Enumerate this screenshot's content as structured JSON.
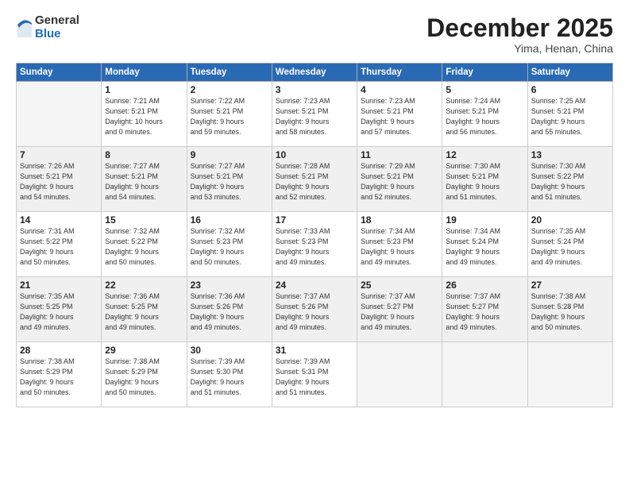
{
  "logo": {
    "general": "General",
    "blue": "Blue"
  },
  "title": "December 2025",
  "location": "Yima, Henan, China",
  "days_header": [
    "Sunday",
    "Monday",
    "Tuesday",
    "Wednesday",
    "Thursday",
    "Friday",
    "Saturday"
  ],
  "weeks": [
    [
      {
        "day": "",
        "info": ""
      },
      {
        "day": "1",
        "info": "Sunrise: 7:21 AM\nSunset: 5:21 PM\nDaylight: 10 hours\nand 0 minutes."
      },
      {
        "day": "2",
        "info": "Sunrise: 7:22 AM\nSunset: 5:21 PM\nDaylight: 9 hours\nand 59 minutes."
      },
      {
        "day": "3",
        "info": "Sunrise: 7:23 AM\nSunset: 5:21 PM\nDaylight: 9 hours\nand 58 minutes."
      },
      {
        "day": "4",
        "info": "Sunrise: 7:23 AM\nSunset: 5:21 PM\nDaylight: 9 hours\nand 57 minutes."
      },
      {
        "day": "5",
        "info": "Sunrise: 7:24 AM\nSunset: 5:21 PM\nDaylight: 9 hours\nand 56 minutes."
      },
      {
        "day": "6",
        "info": "Sunrise: 7:25 AM\nSunset: 5:21 PM\nDaylight: 9 hours\nand 55 minutes."
      }
    ],
    [
      {
        "day": "7",
        "info": "Sunrise: 7:26 AM\nSunset: 5:21 PM\nDaylight: 9 hours\nand 54 minutes."
      },
      {
        "day": "8",
        "info": "Sunrise: 7:27 AM\nSunset: 5:21 PM\nDaylight: 9 hours\nand 54 minutes."
      },
      {
        "day": "9",
        "info": "Sunrise: 7:27 AM\nSunset: 5:21 PM\nDaylight: 9 hours\nand 53 minutes."
      },
      {
        "day": "10",
        "info": "Sunrise: 7:28 AM\nSunset: 5:21 PM\nDaylight: 9 hours\nand 52 minutes."
      },
      {
        "day": "11",
        "info": "Sunrise: 7:29 AM\nSunset: 5:21 PM\nDaylight: 9 hours\nand 52 minutes."
      },
      {
        "day": "12",
        "info": "Sunrise: 7:30 AM\nSunset: 5:21 PM\nDaylight: 9 hours\nand 51 minutes."
      },
      {
        "day": "13",
        "info": "Sunrise: 7:30 AM\nSunset: 5:22 PM\nDaylight: 9 hours\nand 51 minutes."
      }
    ],
    [
      {
        "day": "14",
        "info": "Sunrise: 7:31 AM\nSunset: 5:22 PM\nDaylight: 9 hours\nand 50 minutes."
      },
      {
        "day": "15",
        "info": "Sunrise: 7:32 AM\nSunset: 5:22 PM\nDaylight: 9 hours\nand 50 minutes."
      },
      {
        "day": "16",
        "info": "Sunrise: 7:32 AM\nSunset: 5:23 PM\nDaylight: 9 hours\nand 50 minutes."
      },
      {
        "day": "17",
        "info": "Sunrise: 7:33 AM\nSunset: 5:23 PM\nDaylight: 9 hours\nand 49 minutes."
      },
      {
        "day": "18",
        "info": "Sunrise: 7:34 AM\nSunset: 5:23 PM\nDaylight: 9 hours\nand 49 minutes."
      },
      {
        "day": "19",
        "info": "Sunrise: 7:34 AM\nSunset: 5:24 PM\nDaylight: 9 hours\nand 49 minutes."
      },
      {
        "day": "20",
        "info": "Sunrise: 7:35 AM\nSunset: 5:24 PM\nDaylight: 9 hours\nand 49 minutes."
      }
    ],
    [
      {
        "day": "21",
        "info": "Sunrise: 7:35 AM\nSunset: 5:25 PM\nDaylight: 9 hours\nand 49 minutes."
      },
      {
        "day": "22",
        "info": "Sunrise: 7:36 AM\nSunset: 5:25 PM\nDaylight: 9 hours\nand 49 minutes."
      },
      {
        "day": "23",
        "info": "Sunrise: 7:36 AM\nSunset: 5:26 PM\nDaylight: 9 hours\nand 49 minutes."
      },
      {
        "day": "24",
        "info": "Sunrise: 7:37 AM\nSunset: 5:26 PM\nDaylight: 9 hours\nand 49 minutes."
      },
      {
        "day": "25",
        "info": "Sunrise: 7:37 AM\nSunset: 5:27 PM\nDaylight: 9 hours\nand 49 minutes."
      },
      {
        "day": "26",
        "info": "Sunrise: 7:37 AM\nSunset: 5:27 PM\nDaylight: 9 hours\nand 49 minutes."
      },
      {
        "day": "27",
        "info": "Sunrise: 7:38 AM\nSunset: 5:28 PM\nDaylight: 9 hours\nand 50 minutes."
      }
    ],
    [
      {
        "day": "28",
        "info": "Sunrise: 7:38 AM\nSunset: 5:29 PM\nDaylight: 9 hours\nand 50 minutes."
      },
      {
        "day": "29",
        "info": "Sunrise: 7:38 AM\nSunset: 5:29 PM\nDaylight: 9 hours\nand 50 minutes."
      },
      {
        "day": "30",
        "info": "Sunrise: 7:39 AM\nSunset: 5:30 PM\nDaylight: 9 hours\nand 51 minutes."
      },
      {
        "day": "31",
        "info": "Sunrise: 7:39 AM\nSunset: 5:31 PM\nDaylight: 9 hours\nand 51 minutes."
      },
      {
        "day": "",
        "info": ""
      },
      {
        "day": "",
        "info": ""
      },
      {
        "day": "",
        "info": ""
      }
    ]
  ]
}
